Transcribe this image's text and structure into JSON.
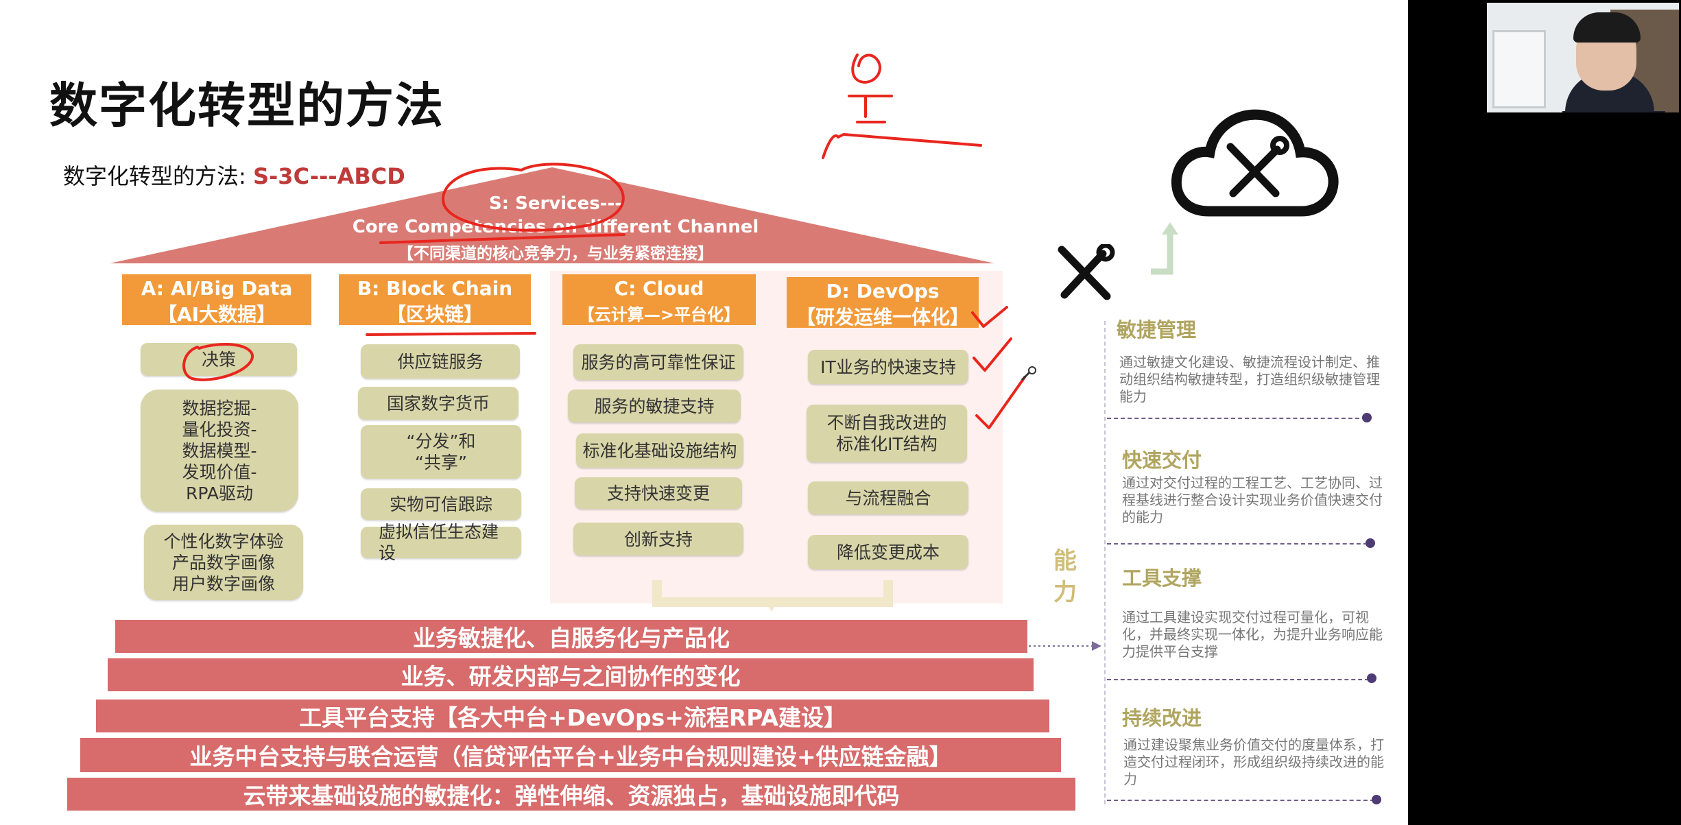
{
  "slide": {
    "title": "数字化转型的方法",
    "subtitle_prefix": "数字化转型的方法: ",
    "subtitle_accent": "S-3C---ABCD"
  },
  "roof": {
    "line1": "S: Services---",
    "line2": "Core Competencies on different Channel",
    "line3": "【不同渠道的核心竞争力，与业务紧密连接】"
  },
  "columns": [
    {
      "title": "A: AI/Big Data",
      "subtitle": "【AI大数据】",
      "items": [
        "决策",
        "数据挖掘-\n量化投资-\n数据模型-\n发现价值-\nRPA驱动",
        "个性化数字体验\n产品数字画像\n用户数字画像"
      ]
    },
    {
      "title": "B: Block Chain",
      "subtitle": "【区块链】",
      "items": [
        "供应链服务",
        "国家数字货币",
        "“分发”和\n“共享”",
        "实物可信跟踪",
        "虚拟信任生态建\n设"
      ]
    },
    {
      "title": "C: Cloud",
      "subtitle": "【云计算—>平台化】",
      "items": [
        "服务的高可靠性保证",
        "服务的敏捷支持",
        "标准化基础设施结构",
        "支持快速变更",
        "创新支持"
      ]
    },
    {
      "title": "D: DevOps",
      "subtitle": "【研发运维一体化】",
      "items": [
        "IT业务的快速支持",
        "不断自我改进的\n标准化IT结构",
        "与流程融合",
        "降低变更成本"
      ]
    }
  ],
  "bands": [
    "业务敏捷化、自服务化与产品化",
    "业务、研发内部与之间协作的变化",
    "工具平台支持【各大中台+DevOps+流程RPA建设】",
    "业务中台支持与联合运营（信贷评估平台+业务中台规则建设+供应链金融】",
    "云带来基础设施的敏捷化：弹性伸缩、资源独占，基础设施即代码"
  ],
  "capability_label": "能\n力",
  "right_panel": [
    {
      "title": "敏捷管理",
      "text": "通过敏捷文化建设、敏捷流程设计制定、推动组织结构敏捷转型，打造组织级敏捷管理能力"
    },
    {
      "title": "快速交付",
      "text": "通过对交付过程的工程工艺、工艺协同、过程基线进行整合设计实现业务价值快速交付的能力"
    },
    {
      "title": "工具支撑",
      "text": "通过工具建设实现交付过程可量化，可视化，并最终实现一体化，为提升业务响应能力提供平台支撑"
    },
    {
      "title": "持续改进",
      "text": "通过建设聚焦业务价值交付的度量体系，打造交付过程闭环，形成组织级持续改进的能力"
    }
  ],
  "colors": {
    "roof": "#d97b74",
    "band": "#d86b6b",
    "column_header": "#f29a3a",
    "pill": "#d8d5a8",
    "accent": "#c03a3a",
    "panel_title": "#b0a55f",
    "annotation": "#e8261e"
  },
  "icons": [
    "cloud-tools-icon",
    "tools-icon",
    "up-arrow-icon",
    "checkmark-icon",
    "pen-cursor-icon"
  ]
}
